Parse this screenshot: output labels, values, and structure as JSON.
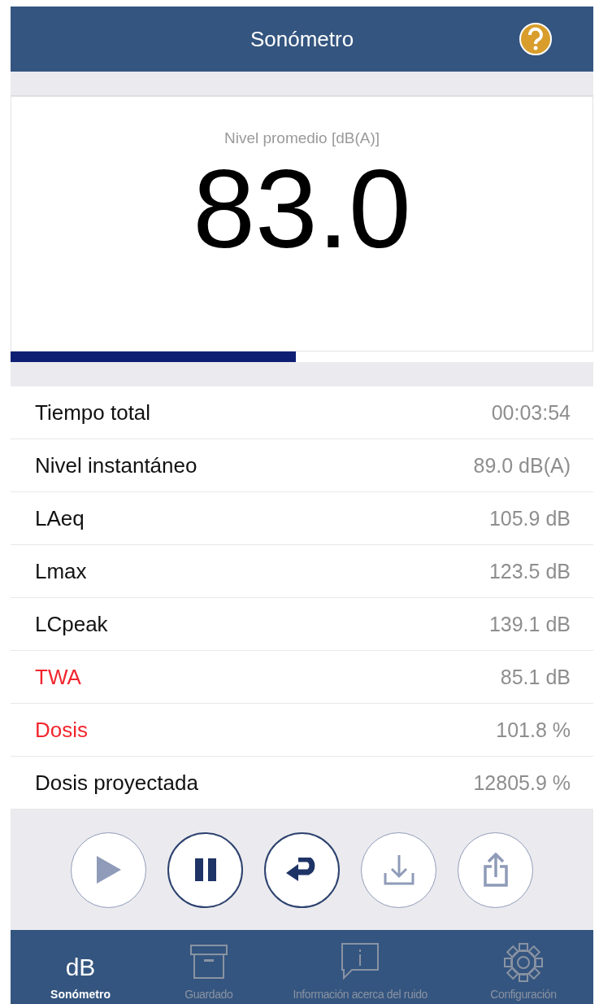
{
  "header": {
    "title": "Sonómetro"
  },
  "meter": {
    "label": "Nivel promedio [dB(A)]",
    "value": "83.0",
    "level": 0.49
  },
  "rows": [
    {
      "label": "Tiempo total",
      "value": "00:03:54",
      "warning": false
    },
    {
      "label": "Nivel instantáneo",
      "value": "89.0 dB(A)",
      "warning": false
    },
    {
      "label": "LAeq",
      "value": "105.9 dB",
      "warning": false
    },
    {
      "label": "Lmax",
      "value": "123.5 dB",
      "warning": false
    },
    {
      "label": "LCpeak",
      "value": "139.1 dB",
      "warning": false
    },
    {
      "label": "TWA",
      "value": "85.1 dB",
      "warning": true
    },
    {
      "label": "Dosis",
      "value": "101.8 %",
      "warning": true
    },
    {
      "label": "Dosis proyectada",
      "value": "12805.9 %",
      "warning": false
    }
  ],
  "controls": [
    {
      "kind": "play",
      "disabled": true
    },
    {
      "kind": "pause",
      "disabled": false
    },
    {
      "kind": "reset",
      "disabled": false
    },
    {
      "kind": "save",
      "disabled": true
    },
    {
      "kind": "share",
      "disabled": true
    }
  ],
  "tabs": [
    {
      "kind": "db",
      "icon_text": "dB",
      "label": "Sonómetro",
      "selected": true
    },
    {
      "kind": "archive",
      "label": "Guardado",
      "selected": false
    },
    {
      "kind": "info",
      "label": "Información acerca del ruido",
      "selected": false
    },
    {
      "kind": "gear",
      "label": "Configuración",
      "selected": false
    }
  ]
}
